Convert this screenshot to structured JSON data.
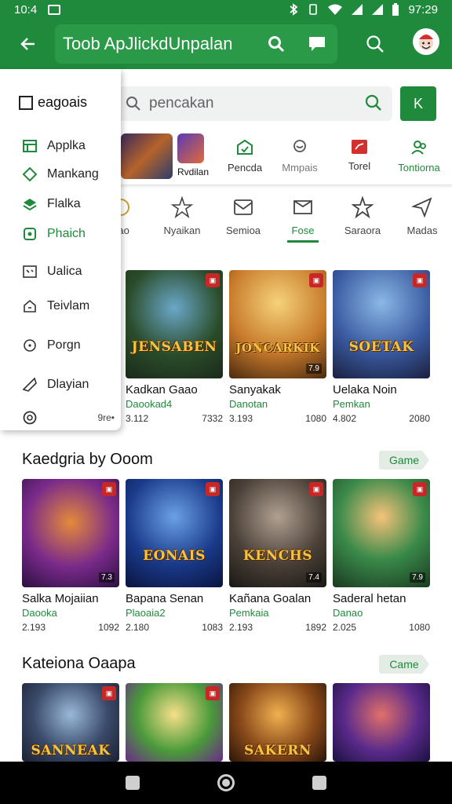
{
  "status_bar": {
    "time_left": "10:4",
    "time_right": "97:29"
  },
  "app_bar": {
    "title": "Toob ApJlickdUnpalan"
  },
  "search": {
    "placeholder": "pencakan",
    "button_label": "K"
  },
  "drawer": {
    "title": "eagoais",
    "items": [
      {
        "label": "Applka",
        "icon": "grid-icon",
        "green": false
      },
      {
        "label": "Mankang",
        "icon": "tag-icon",
        "green": false
      },
      {
        "label": "Flalka",
        "icon": "layers-icon",
        "green": false
      },
      {
        "label": "Phaich",
        "icon": "puzzle-icon",
        "green": true
      },
      {
        "label": "Ualica",
        "icon": "gamepad-icon",
        "green": false
      },
      {
        "label": "Teivlam",
        "icon": "home-icon",
        "green": false
      },
      {
        "label": "Porgn",
        "icon": "circle-icon",
        "green": false
      },
      {
        "label": "Dlayian",
        "icon": "send-icon",
        "green": false
      }
    ],
    "footer_text": "9re•"
  },
  "category_strip": {
    "thumb_label": "Rvdilan",
    "items": [
      {
        "label": "Pencda",
        "icon": "bag-icon"
      },
      {
        "label": "Mmpais",
        "icon": "chat-icon"
      },
      {
        "label": "Torel",
        "icon": "flag-icon"
      },
      {
        "label": "Tontiorna",
        "icon": "people-icon"
      }
    ]
  },
  "category_strip2": {
    "items": [
      {
        "label": "oao",
        "icon": "smile-icon"
      },
      {
        "label": "Nyaikan",
        "icon": "star-burst-icon"
      },
      {
        "label": "Semioa",
        "icon": "mail-icon"
      },
      {
        "label": "Fose",
        "icon": "box-icon",
        "active": true
      },
      {
        "label": "Saraora",
        "icon": "star-icon"
      },
      {
        "label": "Madas",
        "icon": "send-icon"
      }
    ]
  },
  "row1": [
    {
      "title": "Kadkan Gaao",
      "sub": "Daookad4",
      "meta_left": "3.112",
      "meta_right": "7332",
      "art": "JENSABEN",
      "tag": ""
    },
    {
      "title": "Sanyakak",
      "sub": "Danotan",
      "meta_left": "3.193",
      "meta_right": "1080",
      "art": "JONCARKIK",
      "tag": "7.9"
    },
    {
      "title": "Uelaka Noin",
      "sub": "Pemkan",
      "meta_left": "4.802",
      "meta_right": "2080",
      "art": "SOETAK",
      "tag": ""
    }
  ],
  "section2": {
    "title": "Kaedgria by Ooom",
    "chip": "Game"
  },
  "row2": [
    {
      "title": "Salka Mojaiian",
      "sub": "Daooka",
      "meta_left": "2.193",
      "meta_right": "1092",
      "art": "",
      "tag": "7.3"
    },
    {
      "title": "Bapana Senan",
      "sub": "Plaoaia2",
      "meta_left": "2.180",
      "meta_right": "1083",
      "art": "EONAIS",
      "tag": ""
    },
    {
      "title": "Kañana Goalan",
      "sub": "Pemkaia",
      "meta_left": "2.193",
      "meta_right": "1892",
      "art": "KENCHS",
      "tag": "7.4"
    },
    {
      "title": "Saderal hetan",
      "sub": "Danao",
      "meta_left": "2.025",
      "meta_right": "1080",
      "art": "",
      "tag": "7.9"
    }
  ],
  "section3": {
    "title": "Kateiona Oaapa",
    "chip": "Came"
  },
  "row3": [
    {
      "art": "SANNEAK"
    },
    {
      "art": ""
    },
    {
      "art": "SAKERN"
    },
    {
      "art": ""
    }
  ],
  "colors": {
    "accent": "#1f8a3b"
  }
}
